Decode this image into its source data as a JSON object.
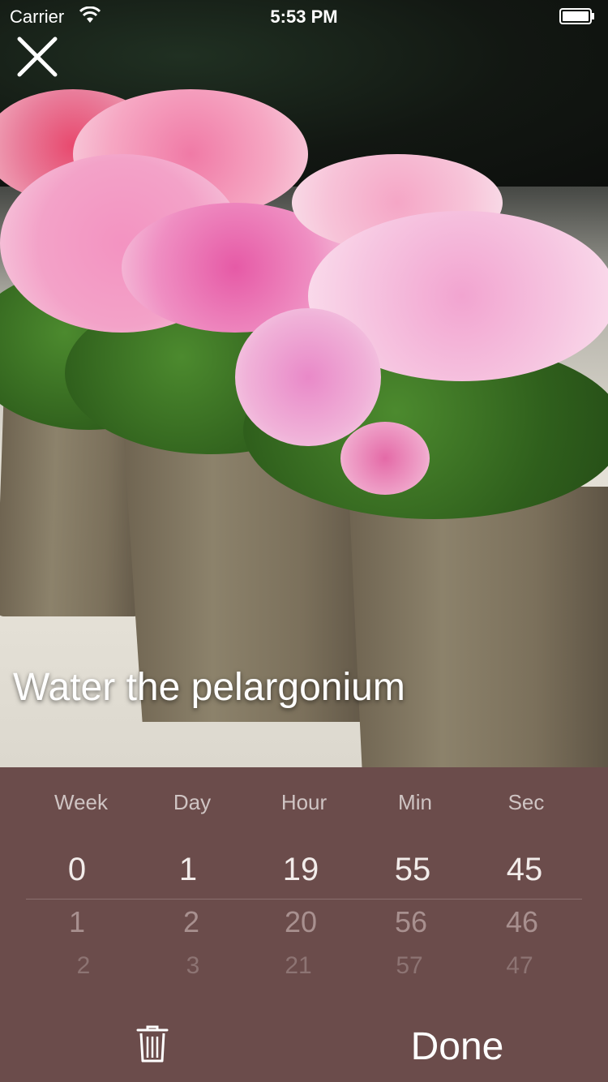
{
  "status_bar": {
    "carrier": "Carrier",
    "time": "5:53 PM",
    "wifi_icon": "wifi-icon",
    "battery_icon": "battery-icon"
  },
  "header": {
    "close_icon": "close-icon"
  },
  "photo": {
    "description_icon": "photo-image"
  },
  "title": "Water the pelargonium",
  "picker": {
    "columns": [
      {
        "label": "Week",
        "selected": "0",
        "next1": "1",
        "next2": "2"
      },
      {
        "label": "Day",
        "selected": "1",
        "next1": "2",
        "next2": "3"
      },
      {
        "label": "Hour",
        "selected": "19",
        "next1": "20",
        "next2": "21"
      },
      {
        "label": "Min",
        "selected": "55",
        "next1": "56",
        "next2": "57"
      },
      {
        "label": "Sec",
        "selected": "45",
        "next1": "46",
        "next2": "47"
      }
    ]
  },
  "actions": {
    "done_label": "Done",
    "delete_icon": "trash-icon"
  },
  "colors": {
    "panel": "#6b4c4b",
    "text_light": "#f2ecea",
    "text_muted": "#a8908f"
  }
}
